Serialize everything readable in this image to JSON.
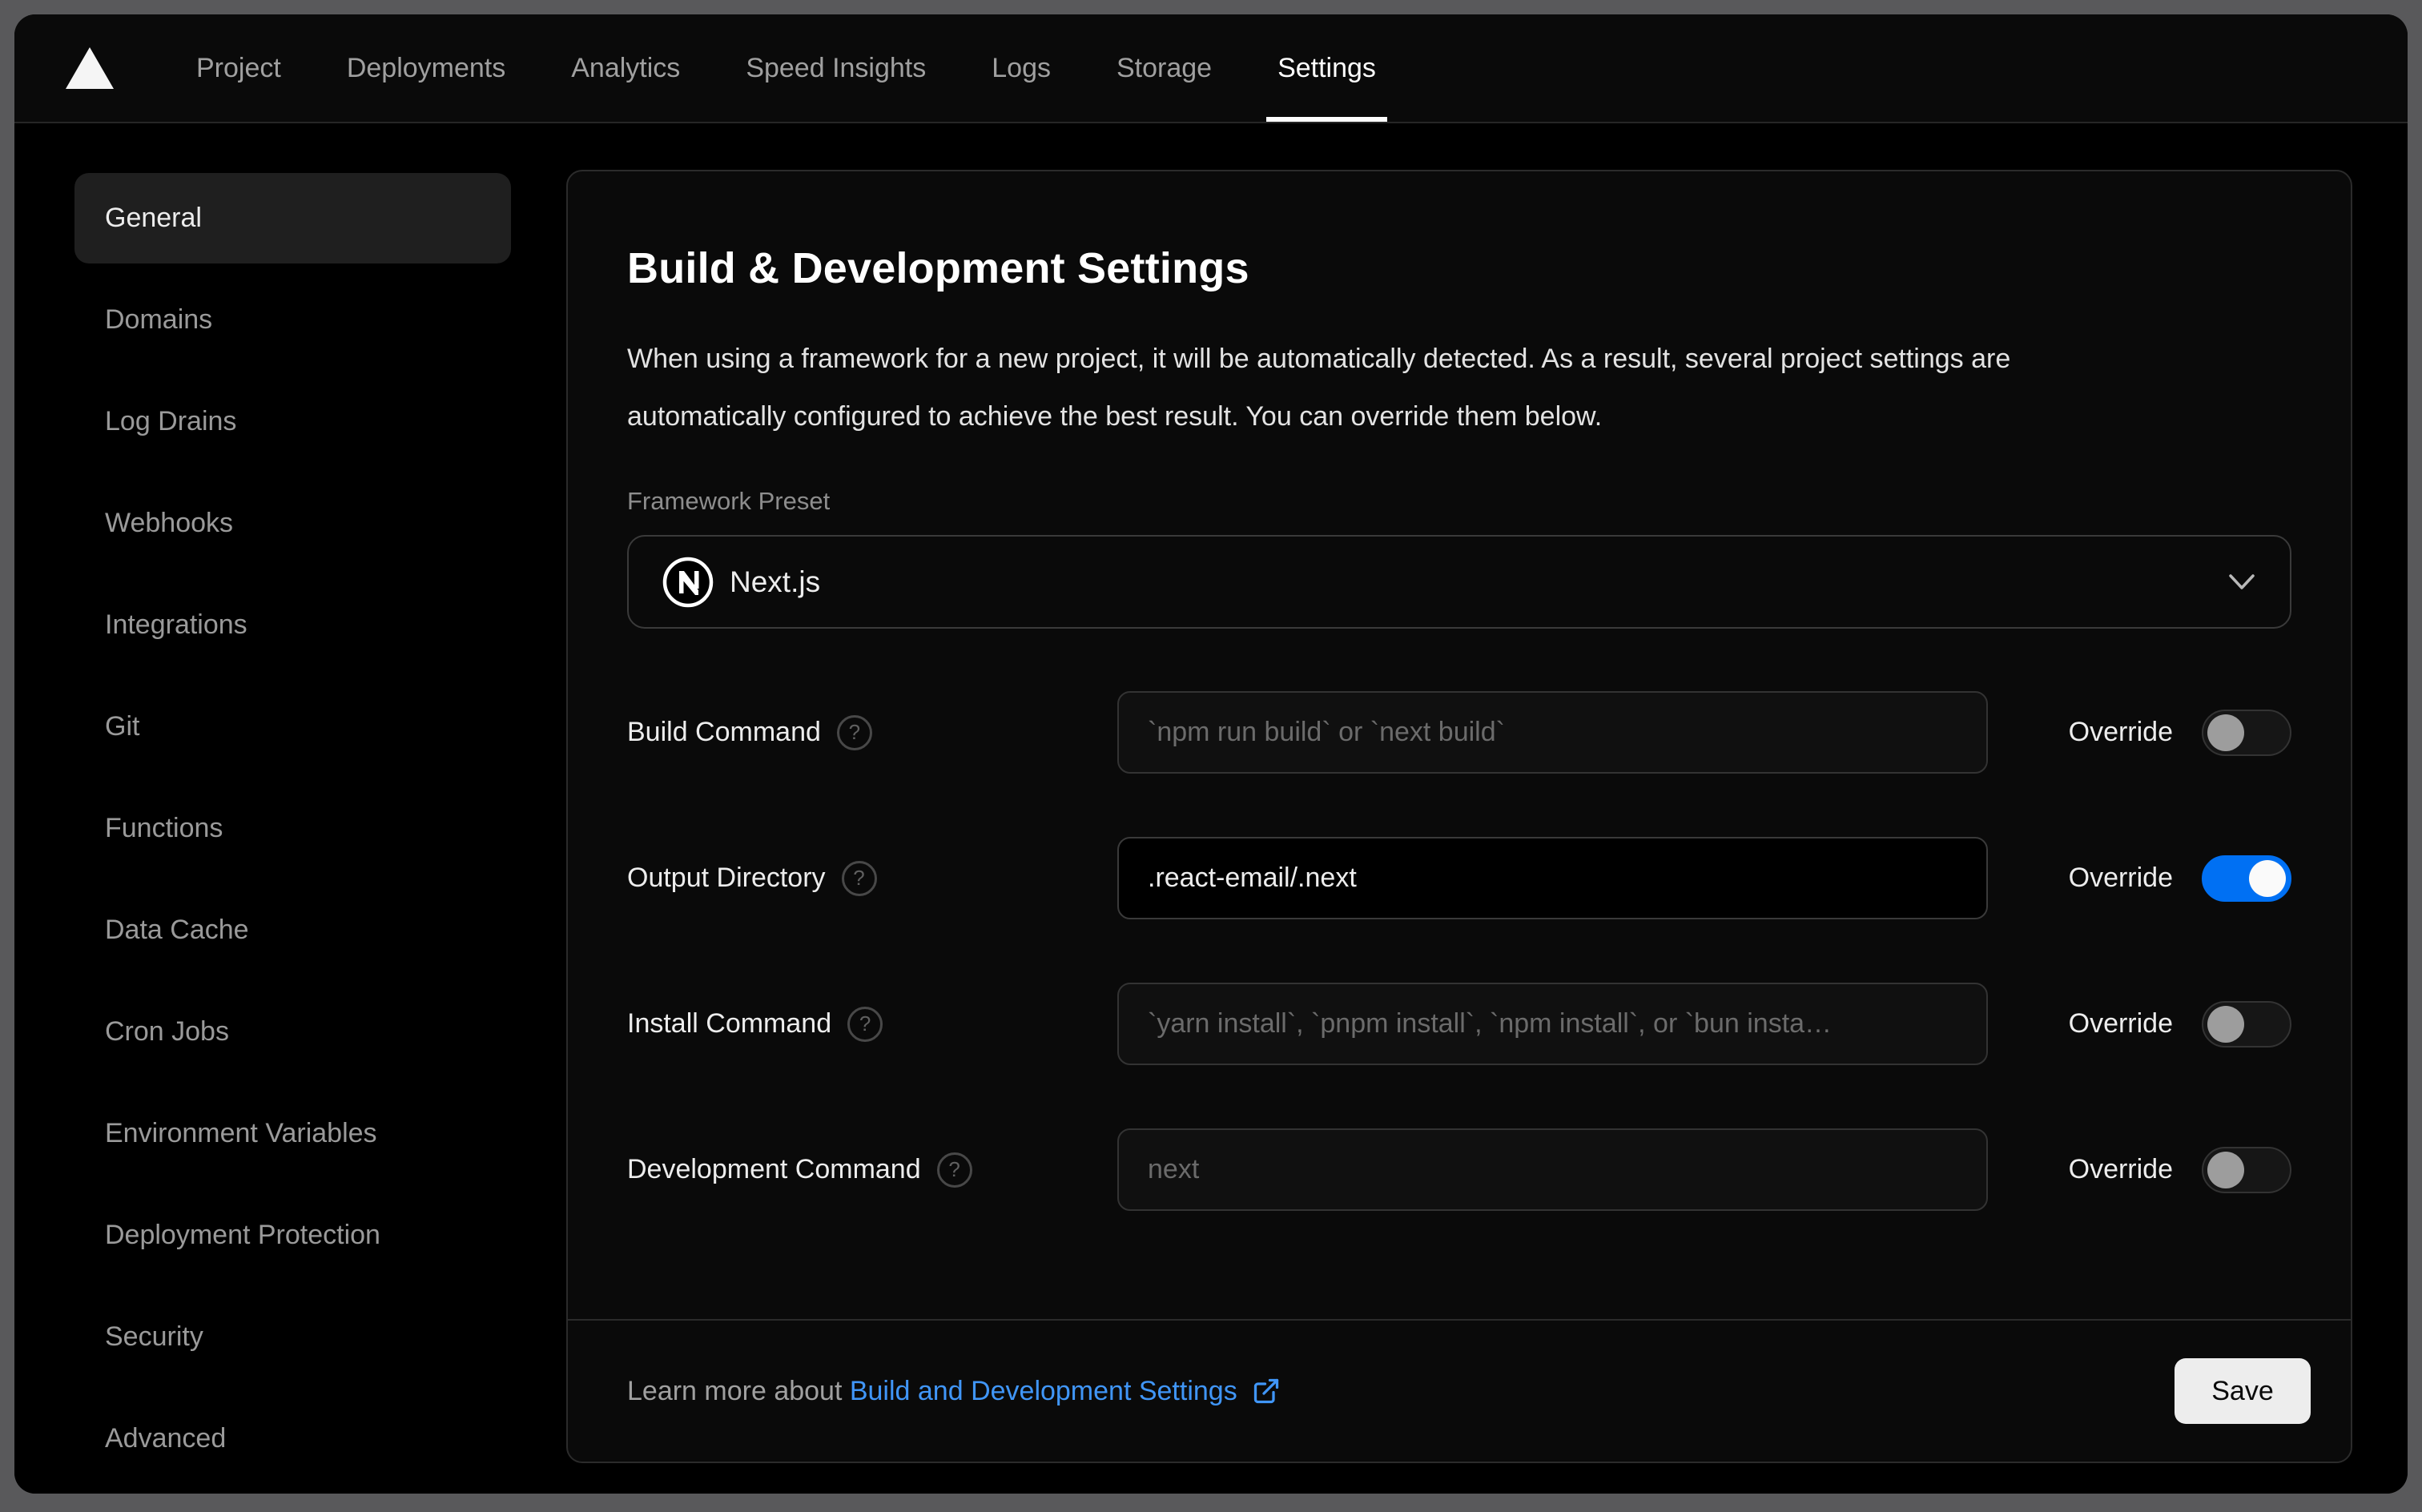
{
  "nav": {
    "logo": "vercel-triangle",
    "tabs": [
      {
        "label": "Project",
        "active": false
      },
      {
        "label": "Deployments",
        "active": false
      },
      {
        "label": "Analytics",
        "active": false
      },
      {
        "label": "Speed Insights",
        "active": false
      },
      {
        "label": "Logs",
        "active": false
      },
      {
        "label": "Storage",
        "active": false
      },
      {
        "label": "Settings",
        "active": true
      }
    ]
  },
  "sidebar": {
    "items": [
      {
        "label": "General",
        "active": true
      },
      {
        "label": "Domains",
        "active": false
      },
      {
        "label": "Log Drains",
        "active": false
      },
      {
        "label": "Webhooks",
        "active": false
      },
      {
        "label": "Integrations",
        "active": false
      },
      {
        "label": "Git",
        "active": false
      },
      {
        "label": "Functions",
        "active": false
      },
      {
        "label": "Data Cache",
        "active": false
      },
      {
        "label": "Cron Jobs",
        "active": false
      },
      {
        "label": "Environment Variables",
        "active": false
      },
      {
        "label": "Deployment Protection",
        "active": false
      },
      {
        "label": "Security",
        "active": false
      },
      {
        "label": "Advanced",
        "active": false
      }
    ]
  },
  "panel": {
    "title": "Build & Development Settings",
    "description": "When using a framework for a new project, it will be automatically detected. As a result, several project settings are automatically configured to achieve the best result. You can override them below.",
    "framework": {
      "label": "Framework Preset",
      "value": "Next.js",
      "icon": "nextjs-logo",
      "chevron": "chevron-down-icon"
    },
    "override_label": "Override",
    "rows": [
      {
        "label": "Build Command",
        "placeholder": "`npm run build` or `next build`",
        "value": "",
        "override": false
      },
      {
        "label": "Output Directory",
        "placeholder": "",
        "value": ".react-email/.next",
        "override": true
      },
      {
        "label": "Install Command",
        "placeholder": "`yarn install`, `pnpm install`, `npm install`, or `bun insta…",
        "value": "",
        "override": false
      },
      {
        "label": "Development Command",
        "placeholder": "next",
        "value": "",
        "override": false
      }
    ],
    "help_glyph": "?",
    "footer": {
      "text": "Learn more about ",
      "link_label": "Build and Development Settings",
      "link_icon": "external-link-icon",
      "save_label": "Save"
    }
  },
  "colors": {
    "frame": "#59595b",
    "window_bg": "#000000",
    "panel_bg": "#0a0a0a",
    "border": "#2b2b2b",
    "accent_blue": "#0070f3",
    "link_blue": "#4096f8",
    "active_text": "#ededed",
    "muted_text": "#a0a0a0",
    "save_bg": "#ededed"
  }
}
